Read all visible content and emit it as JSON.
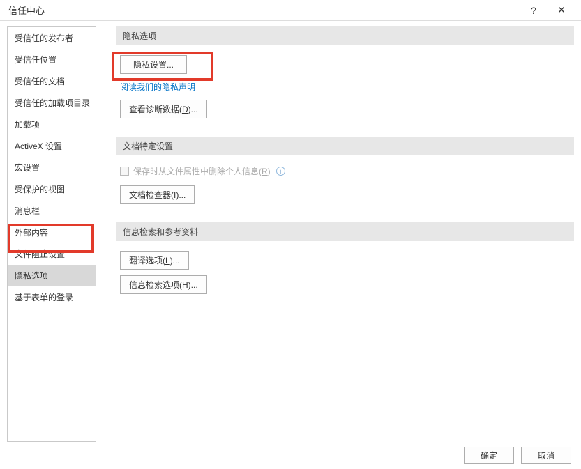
{
  "titlebar": {
    "title": "信任中心",
    "help": "?",
    "close": "✕"
  },
  "sidebar": {
    "items": [
      {
        "label": "受信任的发布者"
      },
      {
        "label": "受信任位置"
      },
      {
        "label": "受信任的文档"
      },
      {
        "label": "受信任的加载项目录"
      },
      {
        "label": "加载项"
      },
      {
        "label": "ActiveX 设置"
      },
      {
        "label": "宏设置"
      },
      {
        "label": "受保护的视图"
      },
      {
        "label": "消息栏"
      },
      {
        "label": "外部内容"
      },
      {
        "label": "文件阻止设置"
      },
      {
        "label": "隐私选项",
        "selected": true
      },
      {
        "label": "基于表单的登录"
      }
    ]
  },
  "sections": {
    "privacy": {
      "header": "隐私选项",
      "privacy_settings_btn": "隐私设置...",
      "privacy_statement_link": "阅读我们的隐私声明",
      "diagnostic_btn_prefix": "查看诊断数据(",
      "diagnostic_btn_acc": "D",
      "diagnostic_btn_suffix": ")..."
    },
    "docspec": {
      "header": "文档特定设置",
      "remove_personal_prefix": "保存时从文件属性中删除个人信息(",
      "remove_personal_acc": "R",
      "remove_personal_suffix": ")",
      "inspector_btn_prefix": "文档检查器(",
      "inspector_btn_acc": "I",
      "inspector_btn_suffix": ")..."
    },
    "research": {
      "header": "信息检索和参考资料",
      "translate_btn_prefix": "翻译选项(",
      "translate_btn_acc": "L",
      "translate_btn_suffix": ")...",
      "research_btn_prefix": "信息检索选项(",
      "research_btn_acc": "H",
      "research_btn_suffix": ")..."
    }
  },
  "footer": {
    "ok": "确定",
    "cancel": "取消"
  }
}
